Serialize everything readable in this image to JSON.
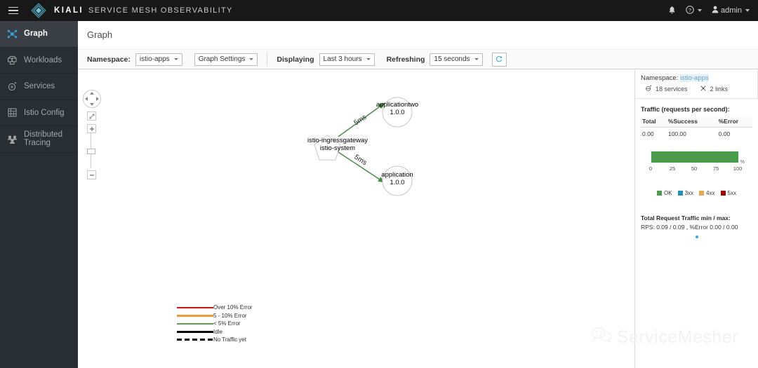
{
  "masthead": {
    "hamburger_name": "menu-icon",
    "brand_name": "KIALI",
    "brand_tagline": "SERVICE MESH OBSERVABILITY",
    "notifications_icon": "bell-icon",
    "help_icon": "help-circle-icon",
    "user_icon": "user-icon",
    "user_label": "admin"
  },
  "sidebar": {
    "items": [
      {
        "label": "Graph",
        "icon": "topology-icon",
        "active": true
      },
      {
        "label": "Workloads",
        "icon": "cubes-icon",
        "active": false
      },
      {
        "label": "Services",
        "icon": "service-icon",
        "active": false
      },
      {
        "label": "Istio Config",
        "icon": "config-grid-icon",
        "active": false
      },
      {
        "label": "Distributed Tracing",
        "icon": "tracing-icon",
        "active": false
      }
    ]
  },
  "page": {
    "title": "Graph"
  },
  "toolbar": {
    "namespace_label": "Namespace:",
    "namespace_value": "istio-apps",
    "graph_settings_label": "Graph Settings",
    "displaying_label": "Displaying",
    "displaying_value": "Last 3 hours",
    "refreshing_label": "Refreshing",
    "refreshing_value": "15 seconds",
    "refresh_button_icon": "refresh-icon"
  },
  "controls": {
    "pan_name": "pan-control",
    "fit_label": "fit-to-screen",
    "zoom_in_label": "+",
    "zoom_out_label": "−"
  },
  "graph": {
    "nodes": [
      {
        "id": "gateway",
        "shape": "pentagon",
        "line1": "istio-ingressgateway",
        "line2": "istio-system"
      },
      {
        "id": "applicationtwo",
        "shape": "circle",
        "line1": "applicationtwo",
        "line2": "1.0.0"
      },
      {
        "id": "application",
        "shape": "circle",
        "line1": "application",
        "line2": "1.0.0"
      }
    ],
    "edges": [
      {
        "from": "gateway",
        "to": "applicationtwo",
        "label": "5ms",
        "color": "#4d9a4d"
      },
      {
        "from": "gateway",
        "to": "application",
        "label": "5ms",
        "color": "#4d9a4d"
      }
    ],
    "legend": [
      {
        "label": "Over 10% Error",
        "color": "#c9190b",
        "style": "solid"
      },
      {
        "label": "5 - 10% Error",
        "color": "#ec9b3b",
        "style": "solid"
      },
      {
        "label": "< 5% Error",
        "color": "#5ba352",
        "style": "solid"
      },
      {
        "label": "Idle",
        "color": "#030303",
        "style": "solid"
      },
      {
        "label": "No Traffic yet",
        "color": "#030303",
        "style": "dashed"
      }
    ]
  },
  "side_panel": {
    "namespace_label": "Namespace:",
    "namespace_value": "istio-apps",
    "services_count": "18 services",
    "links_count": "2 links",
    "traffic_title": "Traffic (requests per second):",
    "traffic_headers": [
      "Total",
      "%Success",
      "%Error"
    ],
    "traffic_values": [
      "0.00",
      "100.00",
      "0.00"
    ],
    "total_title": "Total Request Traffic min / max:",
    "total_value": "RPS: 0.09 / 0.09 , %Error 0.00 / 0.00"
  },
  "chart_data": {
    "type": "bar",
    "title": "Traffic (requests per second):",
    "orientation": "horizontal",
    "categories": [
      "OK"
    ],
    "values": [
      100
    ],
    "xlabel": "%",
    "ylabel": "",
    "xlim": [
      0,
      100
    ],
    "xticks": [
      "0",
      "25",
      "50",
      "75",
      "100"
    ],
    "grid": true,
    "legend_position": "bottom",
    "legend": [
      {
        "name": "OK",
        "color": "#4a9c4a",
        "value": 100
      },
      {
        "name": "3xx",
        "color": "#2191b5",
        "value": 0
      },
      {
        "name": "4xx",
        "color": "#e2a951",
        "value": 0
      },
      {
        "name": "5xx",
        "color": "#a30000",
        "value": 0
      }
    ]
  },
  "watermark": {
    "text": "ServiceMesher",
    "icon": "wechat-icon"
  }
}
